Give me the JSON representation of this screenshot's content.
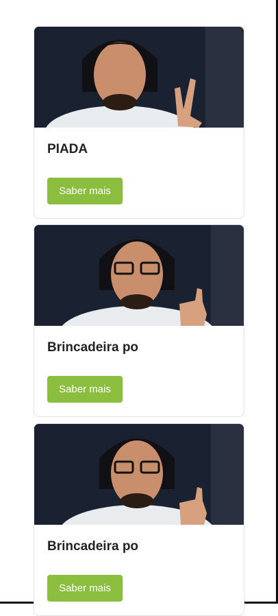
{
  "cards": [
    {
      "title": "PIADA",
      "button_label": "Saber mais",
      "image": "person-peace-sign-photo"
    },
    {
      "title": "Brincadeira po",
      "button_label": "Saber mais",
      "image": "person-thumbs-up-photo"
    },
    {
      "title": "Brincadeira po",
      "button_label": "Saber mais",
      "image": "person-thumbs-up-photo"
    }
  ],
  "colors": {
    "button": "#8bbd3e",
    "title": "#222222",
    "border": "#e3e3e3"
  }
}
